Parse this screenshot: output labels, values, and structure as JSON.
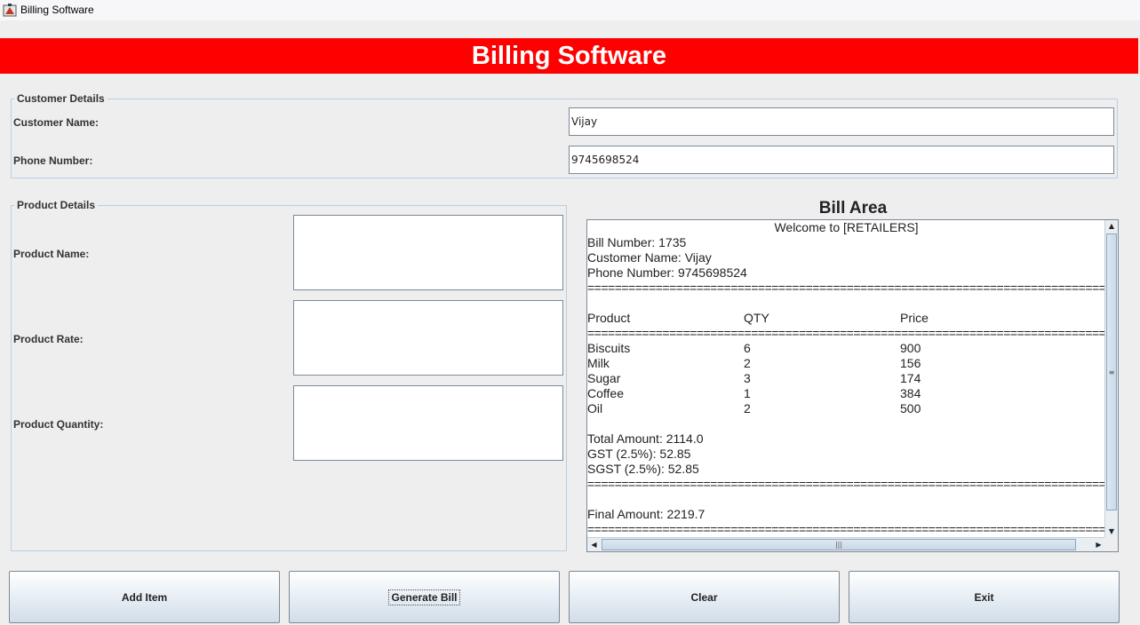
{
  "window": {
    "title": "Billing Software",
    "icon": "java-app-icon"
  },
  "header": {
    "title": "Billing Software",
    "background": "#ff0000"
  },
  "customer_details": {
    "legend": "Customer Details",
    "name_label": "Customer Name:",
    "name_value": "Vijay",
    "phone_label": "Phone Number:",
    "phone_value": "9745698524"
  },
  "product_details": {
    "legend": "Product Details",
    "name_label": "Product Name:",
    "name_value": "",
    "rate_label": "Product Rate:",
    "rate_value": "",
    "quantity_label": "Product Quantity:",
    "quantity_value": ""
  },
  "bill": {
    "title": "Bill Area",
    "welcome": "Welcome to [RETAILERS]",
    "bill_number": "Bill Number: 1735",
    "customer_name": "Customer Name: Vijay",
    "phone_number": "Phone Number: 9745698524",
    "separator": "===================================================================================================",
    "headers": [
      "Product",
      "QTY",
      "Price"
    ],
    "items": [
      {
        "product": "Biscuits",
        "qty": "6",
        "price": "900"
      },
      {
        "product": "Milk",
        "qty": "2",
        "price": "156"
      },
      {
        "product": "Sugar",
        "qty": "3",
        "price": "174"
      },
      {
        "product": "Coffee",
        "qty": "1",
        "price": "384"
      },
      {
        "product": "Oil",
        "qty": "2",
        "price": "500"
      }
    ],
    "total_amount": "Total Amount: 2114.0",
    "gst": "GST (2.5%): 52.85",
    "sgst": "SGST (2.5%): 52.85",
    "final_amount": "Final Amount: 2219.7"
  },
  "buttons": {
    "add_item": "Add Item",
    "generate_bill": "Generate Bill",
    "clear": "Clear",
    "exit": "Exit"
  }
}
